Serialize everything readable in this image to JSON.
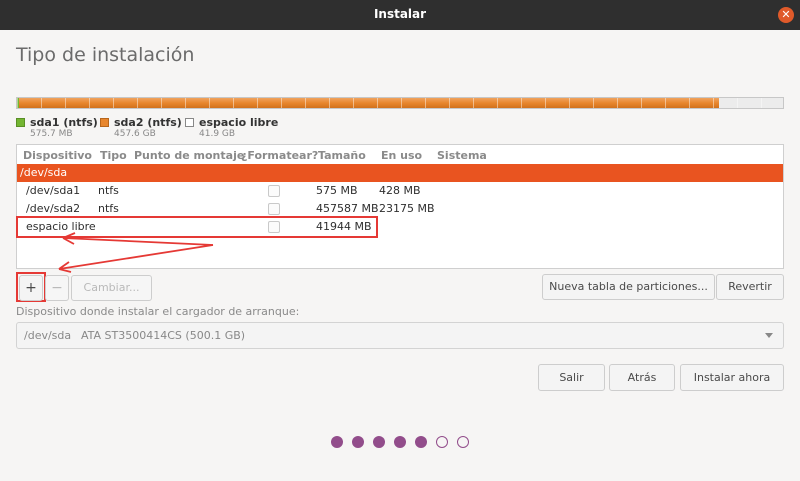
{
  "window": {
    "title": "Instalar"
  },
  "page": {
    "title": "Tipo de instalación"
  },
  "colors": {
    "sda1": "#73b532",
    "sda2": "#e8862d",
    "free": "#ffffff",
    "selected_row": "#e95420",
    "annotation": "#e53935",
    "progress_dots": "#924d8b"
  },
  "partitions_bar": {
    "sda1_share": 0.0011,
    "sda2_share": 0.9152,
    "free_share": 0.0837
  },
  "legend": [
    {
      "name": "sda1 (ntfs)",
      "size": "575.7 MB"
    },
    {
      "name": "sda2 (ntfs)",
      "size": "457.6 GB"
    },
    {
      "name": "espacio libre",
      "size": "41.9 GB"
    }
  ],
  "table": {
    "headers": [
      "Dispositivo",
      "Tipo",
      "Punto de montaje",
      "¿Formatear?",
      "Tamaño",
      "En uso",
      "Sistema"
    ],
    "device": "/dev/sda",
    "rows": [
      {
        "device": "/dev/sda1",
        "type": "ntfs",
        "mount": "",
        "format": false,
        "size": "575 MB",
        "used": "428 MB",
        "system": ""
      },
      {
        "device": "/dev/sda2",
        "type": "ntfs",
        "mount": "",
        "format": false,
        "size": "457587 MB",
        "used": "23175 MB",
        "system": ""
      },
      {
        "device": "espacio libre",
        "type": "",
        "mount": "",
        "format": false,
        "size": "41944 MB",
        "used": "",
        "system": ""
      }
    ]
  },
  "actions": {
    "add": "+",
    "remove": "−",
    "change": "Cambiar...",
    "new_table": "Nueva tabla de particiones...",
    "revert": "Revertir"
  },
  "bootloader": {
    "label": "Dispositivo donde instalar el cargador de arranque:",
    "device": "/dev/sda",
    "model": "ATA ST3500414CS (500.1 GB)"
  },
  "footer": {
    "quit": "Salir",
    "back": "Atrás",
    "install": "Instalar ahora"
  },
  "progress": {
    "steps": 7,
    "completed": 5
  }
}
